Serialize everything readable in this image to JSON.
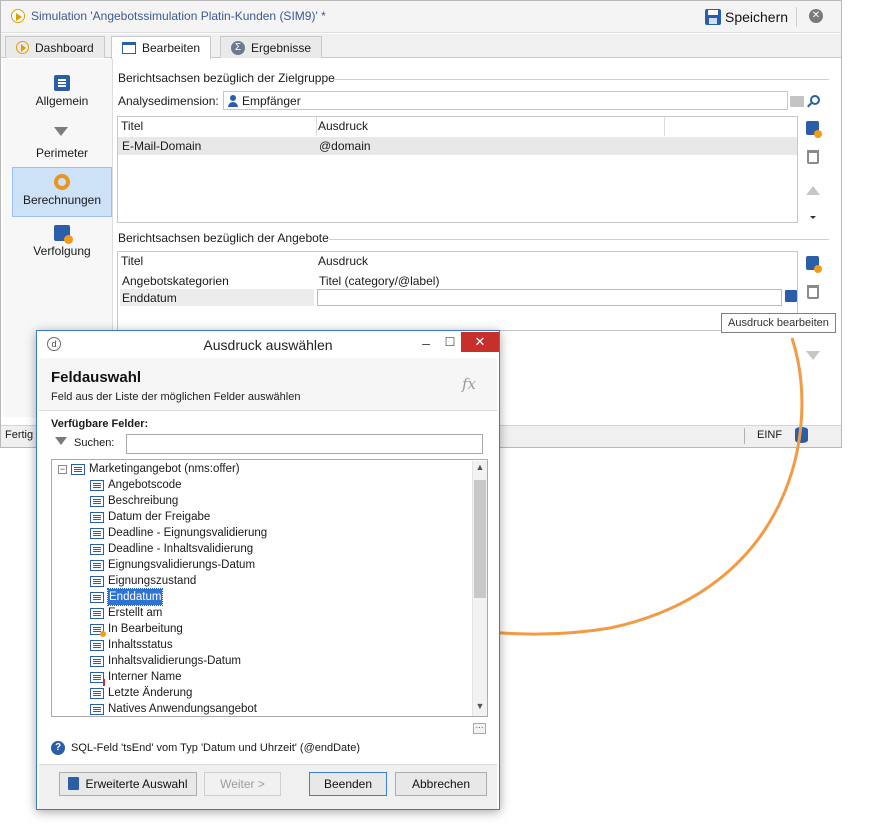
{
  "main_window": {
    "title": "Simulation 'Angebotssimulation Platin-Kunden (SIM9)' *",
    "save_label": "Speichern",
    "tabs": [
      {
        "label": "Dashboard"
      },
      {
        "label": "Bearbeiten"
      },
      {
        "label": "Ergebnisse"
      }
    ],
    "nav": [
      {
        "label": "Allgemein"
      },
      {
        "label": "Perimeter"
      },
      {
        "label": "Berechnungen"
      },
      {
        "label": "Verfolgung"
      }
    ],
    "section_target": {
      "heading": "Berichtsachsen bezüglich der Zielgruppe",
      "dimension_label": "Analysedimension:",
      "dimension_value": "Empfänger",
      "columns": [
        "Titel",
        "Ausdruck"
      ],
      "rows": [
        {
          "title": "E-Mail-Domain",
          "expression": "@domain"
        }
      ]
    },
    "section_offers": {
      "heading": "Berichtsachsen bezüglich der Angebote",
      "columns": [
        "Titel",
        "Ausdruck"
      ],
      "rows": [
        {
          "title": "Angebotskategorien",
          "expression": "Titel (category/@label)"
        },
        {
          "title": "Enddatum",
          "expression": ""
        }
      ]
    },
    "tooltip": "Ausdruck bearbeiten",
    "status": {
      "left": "Fertig",
      "lang": "EINF"
    }
  },
  "dialog": {
    "title": "Ausdruck auswählen",
    "header_title": "Feldauswahl",
    "header_subtitle": "Feld aus der Liste der möglichen Felder auswählen",
    "fx_label": "fx",
    "available_fields_label": "Verfügbare Felder:",
    "search_label": "Suchen:",
    "search_value": "",
    "tree_root": "Marketingangebot (nms:offer)",
    "tree_items": [
      {
        "label": "Angebotscode",
        "icon": "field-icon"
      },
      {
        "label": "Beschreibung",
        "icon": "field-icon"
      },
      {
        "label": "Datum der Freigabe",
        "icon": "field-icon"
      },
      {
        "label": "Deadline - Eignungsvalidierung",
        "icon": "field-icon"
      },
      {
        "label": "Deadline - Inhaltsvalidierung",
        "icon": "field-icon"
      },
      {
        "label": "Eignungsvalidierungs-Datum",
        "icon": "field-icon"
      },
      {
        "label": "Eignungszustand",
        "icon": "field-icon"
      },
      {
        "label": "Enddatum",
        "icon": "field-icon",
        "selected": true
      },
      {
        "label": "Erstellt am",
        "icon": "field-icon"
      },
      {
        "label": "In Bearbeitung",
        "icon": "calculated-field-icon"
      },
      {
        "label": "Inhaltsstatus",
        "icon": "field-icon"
      },
      {
        "label": "Inhaltsvalidierungs-Datum",
        "icon": "field-icon"
      },
      {
        "label": "Interner Name",
        "icon": "key-field-icon"
      },
      {
        "label": "Letzte Änderung",
        "icon": "field-icon"
      },
      {
        "label": "Natives Anwendungsangebot",
        "icon": "field-icon"
      }
    ],
    "sql_info": "SQL-Feld 'tsEnd' vom Typ 'Datum und Uhrzeit' (@endDate)",
    "buttons": {
      "advanced": "Erweiterte Auswahl",
      "next": "Weiter >",
      "finish": "Beenden",
      "cancel": "Abbrechen"
    }
  },
  "colors": {
    "accent": "#2a5ea8",
    "highlight_orange": "#f29a44",
    "selection": "#2f73d2",
    "nav_selected_bg": "#cde2f7"
  }
}
